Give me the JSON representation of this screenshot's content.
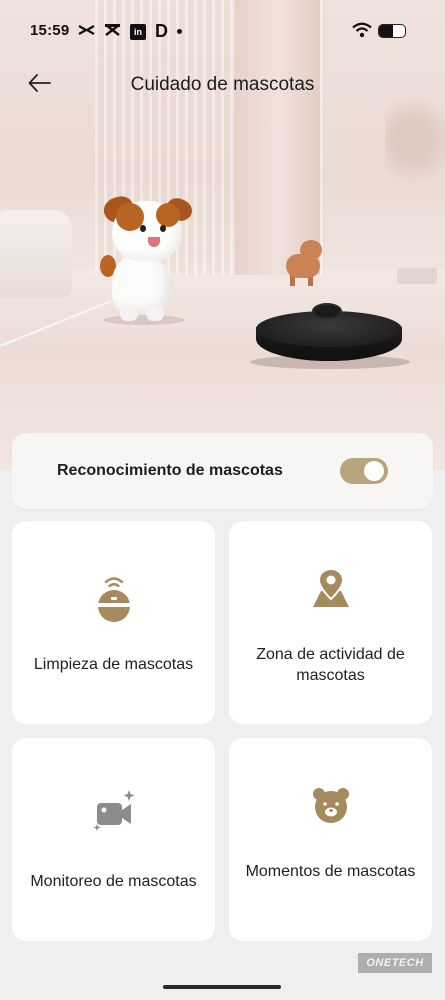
{
  "status_bar": {
    "time": "15:59",
    "app_icons": [
      "capcut-icon",
      "capcut-icon",
      "linkedin-icon",
      "d-app-icon"
    ],
    "linkedin_glyph": "in",
    "d_glyph": "D",
    "battery_level": 0.55
  },
  "header": {
    "title": "Cuidado de mascotas"
  },
  "pet_recognition": {
    "label": "Reconocimiento de mascotas",
    "enabled": true,
    "accent_color": "#b8a57e"
  },
  "features": [
    {
      "label": "Limpieza de mascotas",
      "icon": "robot-vacuum-signal-icon"
    },
    {
      "label": "Zona de actividad de mascotas",
      "icon": "map-pin-icon"
    },
    {
      "label": "Monitoreo de mascotas",
      "icon": "video-camera-icon"
    },
    {
      "label": "Momentos de mascotas",
      "icon": "bear-face-icon"
    }
  ],
  "watermark": "ONETECH",
  "colors": {
    "icon_tan": "#a58a5e",
    "icon_grey": "#8c8c8c",
    "background": "#f1efee"
  }
}
